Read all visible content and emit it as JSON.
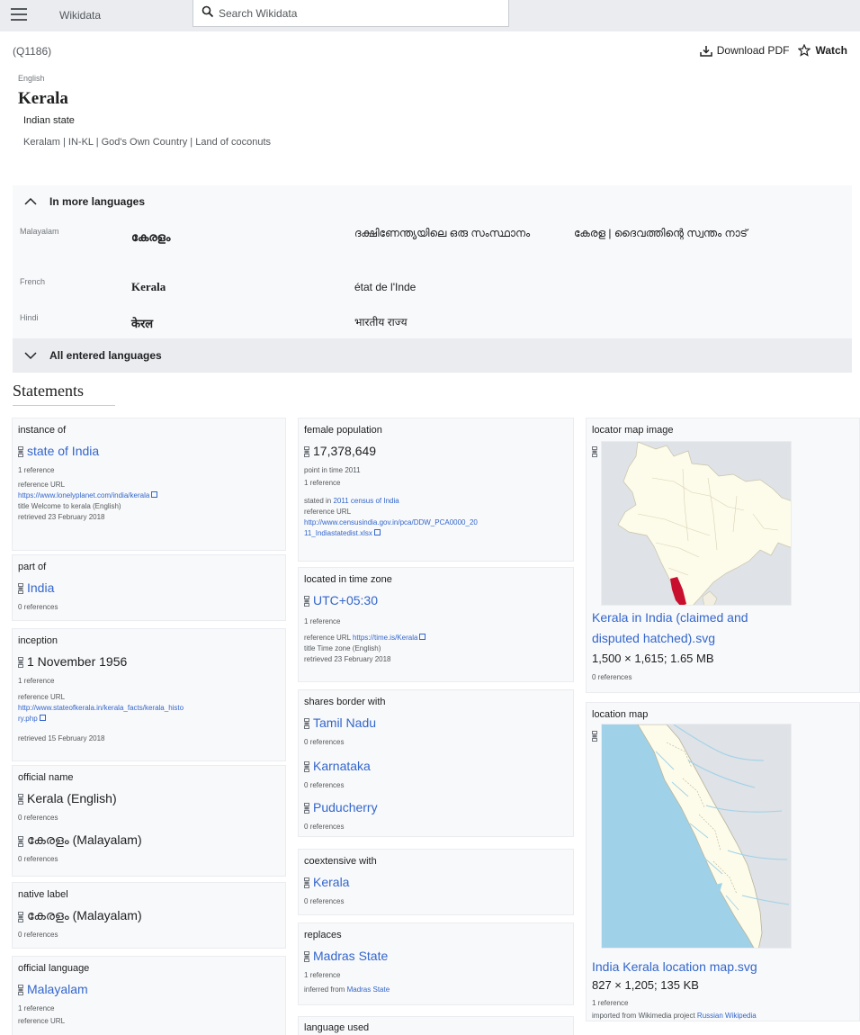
{
  "topbar": {
    "brand": "Wikidata",
    "search_placeholder": "Search Wikidata"
  },
  "header": {
    "qid": "(Q1186)",
    "download_label": "Download PDF",
    "watch_label": "Watch"
  },
  "term": {
    "language": "English",
    "label": "Kerala",
    "description": "Indian state",
    "aliases": "Keralam  |  IN-KL  |  God's Own Country  |  Land of coconuts"
  },
  "more_languages": {
    "title": "In more languages",
    "rows": [
      {
        "language": "Malayalam",
        "label": "കേരളം",
        "description": "ദക്ഷിണേന്ത്യയിലെ ഒരു സംസ്ഥാനം",
        "aliases": "കേരള  |  ദൈവത്തിന്റെ സ്വന്തം നാട്"
      },
      {
        "language": "French",
        "label": "Kerala",
        "description": "état de l'Inde",
        "aliases": ""
      },
      {
        "language": "Hindi",
        "label": "केरल",
        "description": "भारतीय राज्य",
        "aliases": ""
      }
    ],
    "all_entered": "All entered languages"
  },
  "statements_title": "Statements",
  "col1": {
    "instance_of": {
      "prop": "instance of",
      "value": "state of India",
      "refs": "1 reference",
      "ref_url_label": "reference URL",
      "ref_url": "https://www.lonelyplanet.com/india/kerala",
      "title": "title Welcome to kerala (English)",
      "retrieved": "retrieved 23 February 2018"
    },
    "part_of": {
      "prop": "part of",
      "value": "India",
      "refs": "0 references"
    },
    "inception": {
      "prop": "inception",
      "value": "1 November 1956",
      "refs": "1 reference",
      "ref_url_label": "reference URL",
      "ref_url_1": "http://www.stateofkerala.in/kerala_facts/kerala_histo",
      "ref_url_2": "ry.php",
      "retrieved": "retrieved 15 February 2018"
    },
    "official_name": {
      "prop": "official name",
      "value1": "Kerala (English)",
      "refs1": "0 references",
      "value2": "കേരളം (Malayalam)",
      "refs2": "0 references"
    },
    "native_label": {
      "prop": "native label",
      "value": "കേരളം (Malayalam)",
      "refs": "0 references"
    },
    "official_language": {
      "prop": "official language",
      "value": "Malayalam",
      "refs": "1 reference",
      "ref_url_label": "reference URL"
    }
  },
  "col2": {
    "female_population": {
      "prop": "female population",
      "value": "17,378,649",
      "point_in_time": "point in time 2011",
      "refs": "1 reference",
      "stated_in_prefix": "stated in ",
      "stated_in": "2011 census of India",
      "ref_url_label": "reference URL",
      "ref_url_1": "http://www.censusindia.gov.in/pca/DDW_PCA0000_20",
      "ref_url_2": "11_Indiastatedist.xlsx"
    },
    "time_zone": {
      "prop": "located in time zone",
      "value": "UTC+05:30",
      "refs": "1 reference",
      "ref_url_prefix": "reference URL ",
      "ref_url": "https://time.is/Kerala",
      "title": "title Time zone (English)",
      "retrieved": "retrieved 23 February 2018"
    },
    "shares_border": {
      "prop": "shares border with",
      "v1": "Tamil Nadu",
      "r1": "0 references",
      "v2": "Karnataka",
      "r2": "0 references",
      "v3": "Puducherry",
      "r3": "0 references"
    },
    "coextensive": {
      "prop": "coextensive with",
      "value": "Kerala",
      "refs": "0 references"
    },
    "replaces": {
      "prop": "replaces",
      "value": "Madras State",
      "refs": "1 reference",
      "inferred_prefix": "inferred from ",
      "inferred": "Madras State"
    },
    "language_used": {
      "prop": "language used"
    }
  },
  "col3": {
    "locator_map": {
      "prop": "locator map image",
      "file_line1": "Kerala in India (claimed and",
      "file_line2": "disputed hatched).svg",
      "size": "1,500 × 1,615; 1.65 MB",
      "refs": "0 references"
    },
    "location_map": {
      "prop": "location map",
      "file": "India Kerala location map.svg",
      "size": "827 × 1,205; 135 KB",
      "refs": "1 reference",
      "imported_prefix": "imported from Wikimedia project ",
      "imported": "Russian Wikipedia"
    }
  },
  "colors": {
    "link": "#3366cc",
    "kerala_highlight": "#c8102e",
    "map_land": "#fdfbea",
    "map_sea": "#9fd2e8"
  }
}
